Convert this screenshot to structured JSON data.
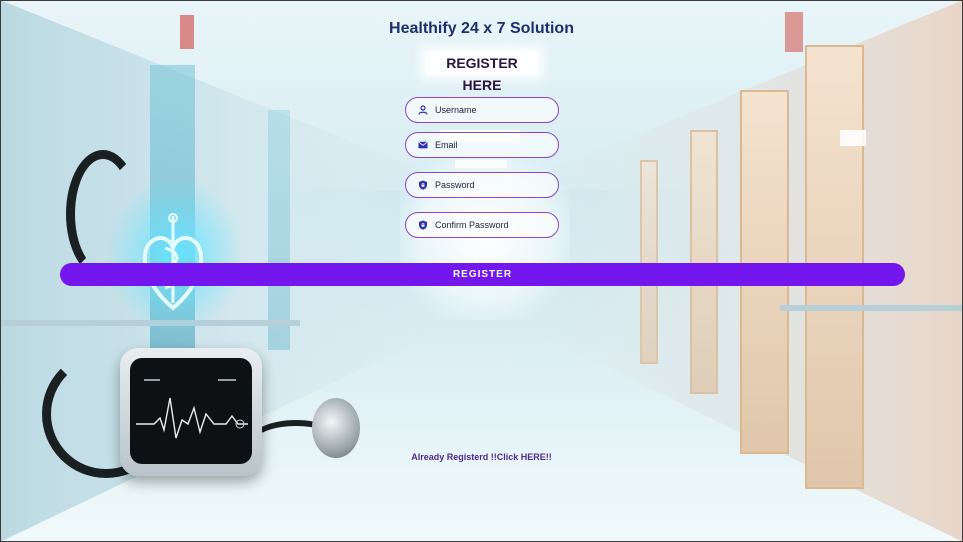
{
  "app": {
    "title": "Healthify 24 x 7 Solution"
  },
  "form": {
    "heading": "REGISTER HERE",
    "fields": [
      {
        "placeholder": "Username",
        "icon": "user-icon"
      },
      {
        "placeholder": "Email",
        "icon": "envelope-icon"
      },
      {
        "placeholder": "Password",
        "icon": "shield-icon"
      },
      {
        "placeholder": "Confirm Password",
        "icon": "shield-icon"
      }
    ],
    "submit_label": "REGISTER",
    "login_link": "Already Registerd !!Click HERE!!"
  },
  "colors": {
    "accent": "#7416ee",
    "field_border": "#8e44c9",
    "title": "#1e2f6e",
    "icon": "#2d2fb5"
  }
}
